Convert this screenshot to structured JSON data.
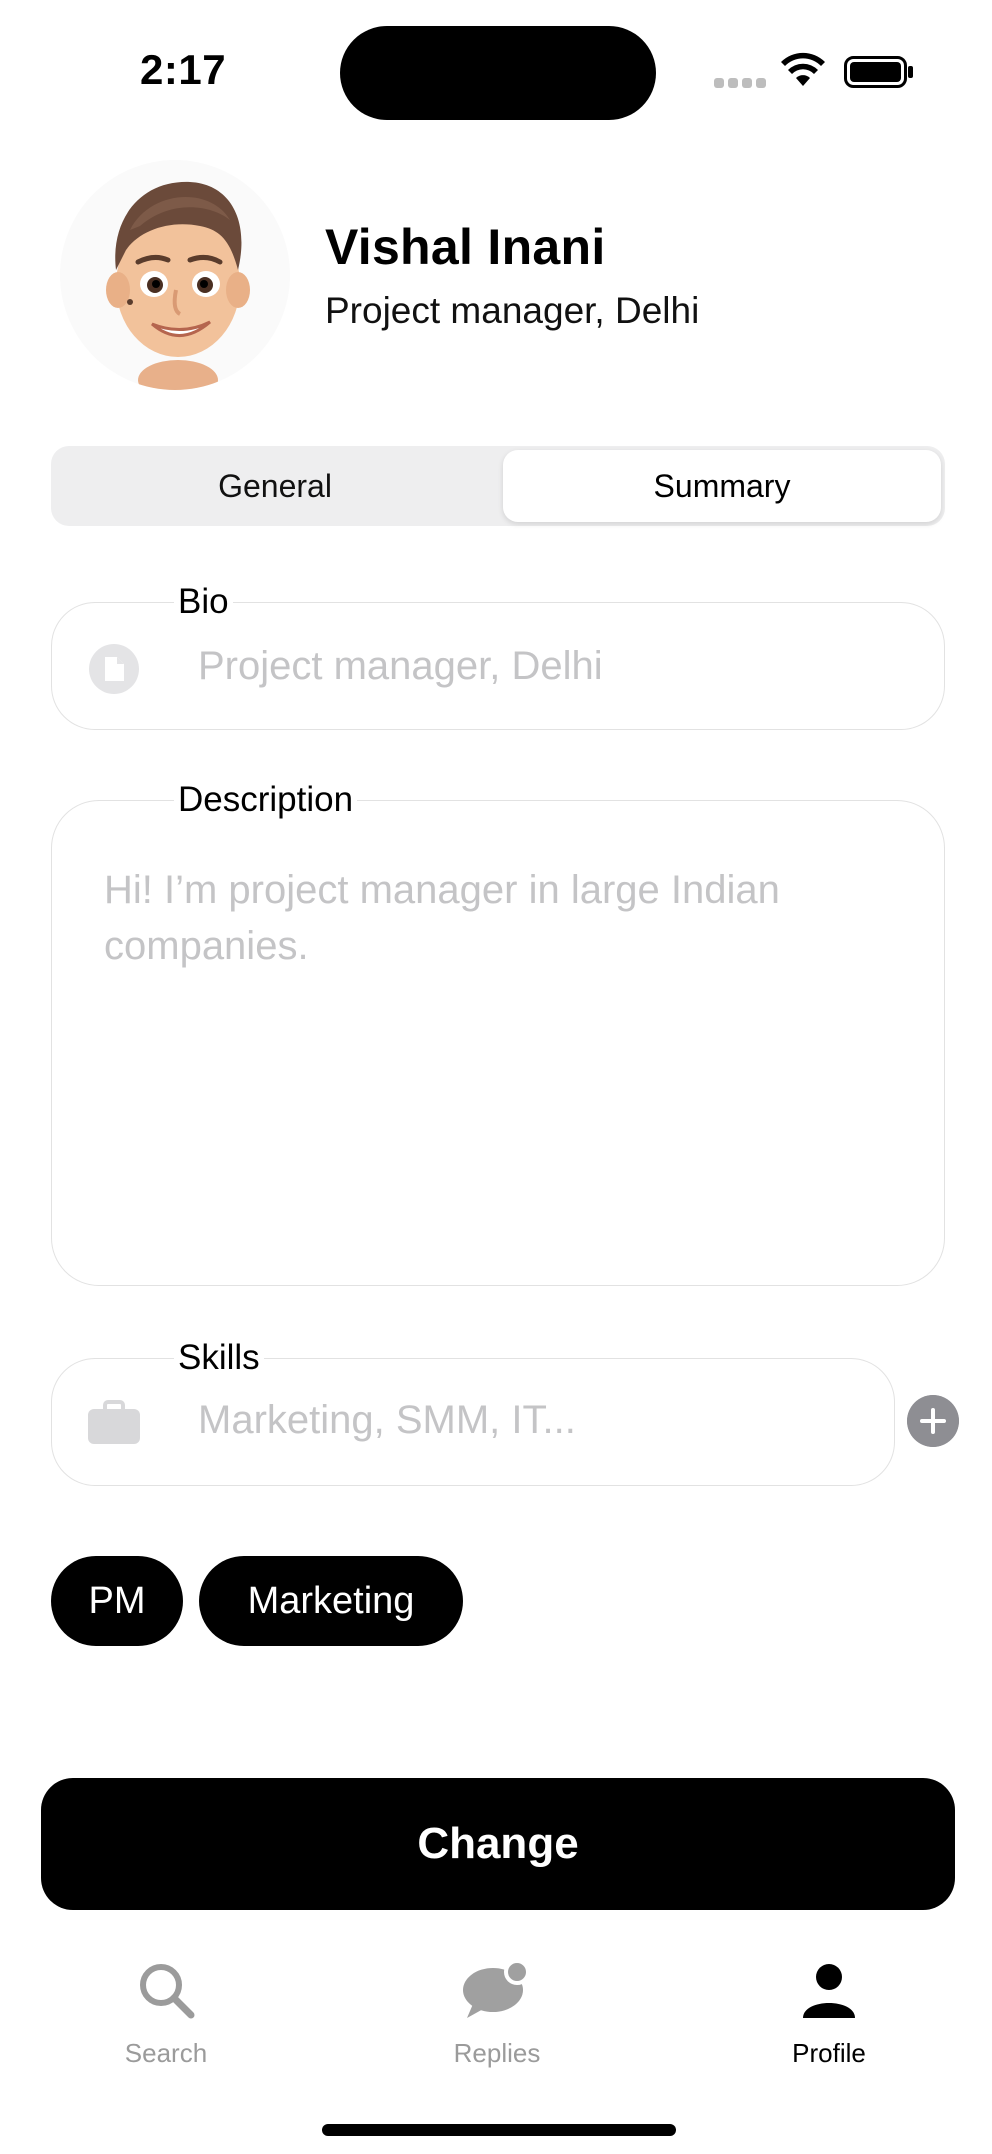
{
  "status_bar": {
    "time": "2:17"
  },
  "profile": {
    "name": "Vishal Inani",
    "role": "Project manager, Delhi"
  },
  "segments": {
    "general_label": "General",
    "summary_label": "Summary",
    "selected": "Summary"
  },
  "bio": {
    "label": "Bio",
    "placeholder": "Project manager, Delhi",
    "icon": "document-icon"
  },
  "description": {
    "label": "Description",
    "placeholder": "Hi! I’m project manager in large Indian companies."
  },
  "skills": {
    "label": "Skills",
    "placeholder": "Marketing, SMM, IT...",
    "icon": "briefcase-icon",
    "chips": [
      "PM",
      "Marketing"
    ]
  },
  "actions": {
    "change_label": "Change"
  },
  "tab_bar": {
    "items": [
      {
        "label": "Search",
        "icon": "search-icon",
        "active": false
      },
      {
        "label": "Replies",
        "icon": "chat-bubble-icon",
        "active": false
      },
      {
        "label": "Profile",
        "icon": "person-icon",
        "active": true
      }
    ]
  },
  "colors": {
    "accent": "#000000",
    "placeholder": "#c4c4c6",
    "inactive_tab": "#9b9b9b",
    "segment_bg": "#eeeeef"
  }
}
